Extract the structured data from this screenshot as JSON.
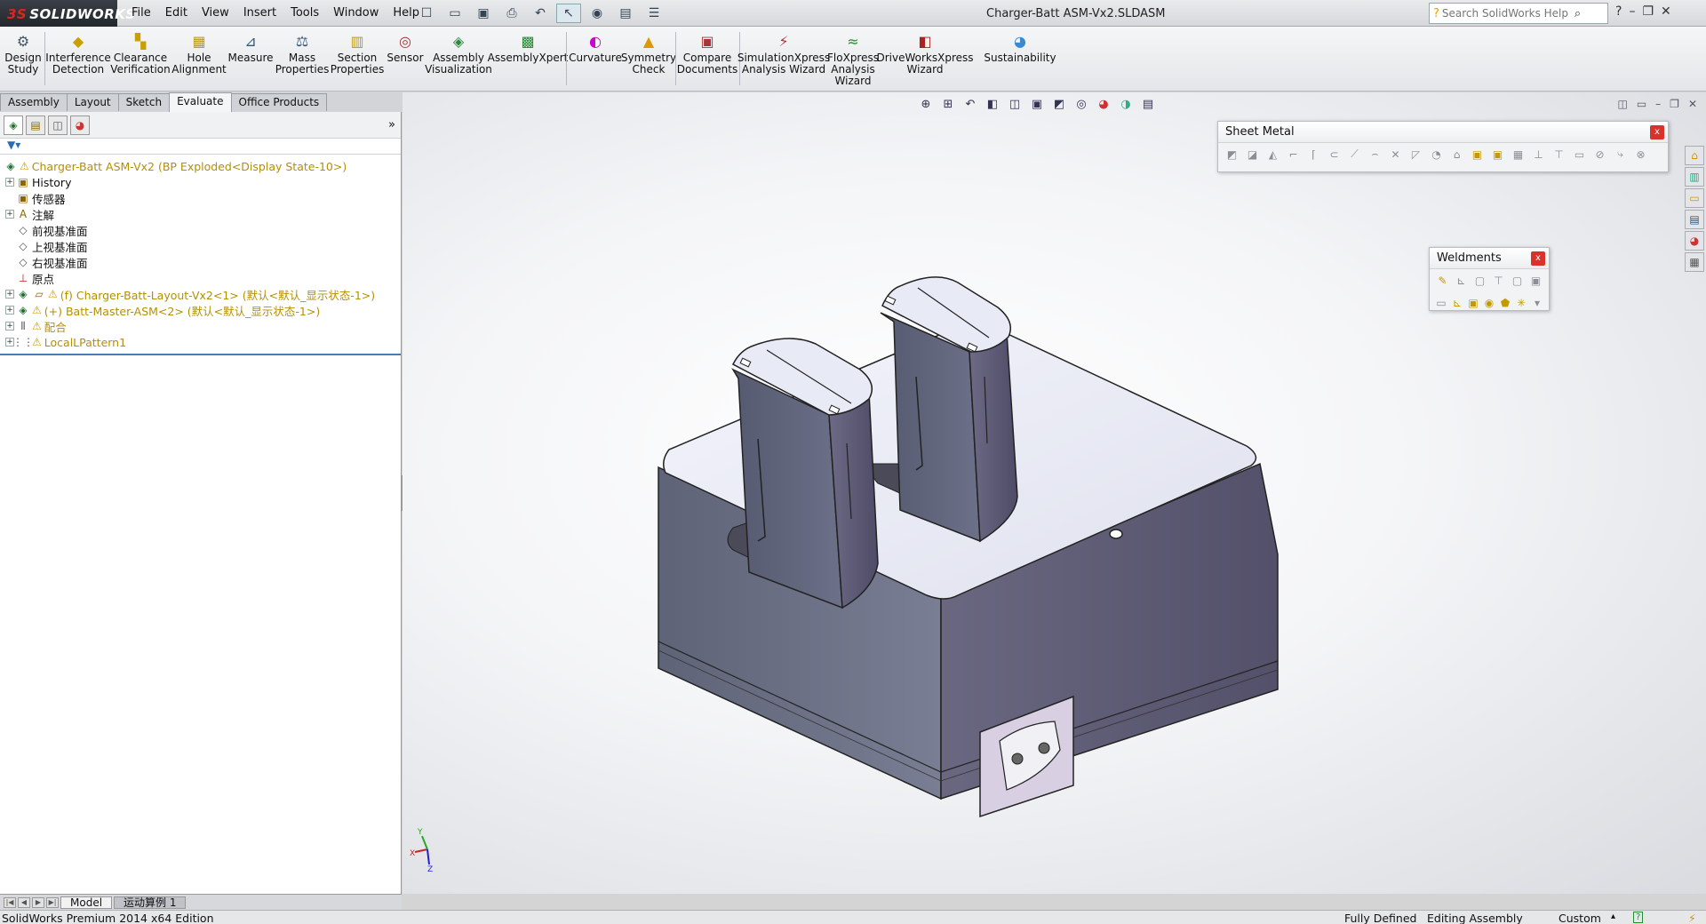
{
  "app": {
    "logo_text": "SOLIDWORKS",
    "title": "Charger-Batt ASM-Vx2.SLDASM"
  },
  "menu": [
    "File",
    "Edit",
    "View",
    "Insert",
    "Tools",
    "Window",
    "Help"
  ],
  "search": {
    "placeholder": "Search SolidWorks Help"
  },
  "command_manager": {
    "commands": [
      {
        "label": "Design Study",
        "icon": "design-study-icon"
      },
      {
        "label": "Interference Detection",
        "icon": "interference-icon"
      },
      {
        "label": "Clearance Verification",
        "icon": "clearance-icon"
      },
      {
        "label": "Hole Alignment",
        "icon": "hole-alignment-icon"
      },
      {
        "label": "Measure",
        "icon": "measure-icon"
      },
      {
        "label": "Mass Properties",
        "icon": "mass-properties-icon"
      },
      {
        "label": "Section Properties",
        "icon": "section-properties-icon"
      },
      {
        "label": "Sensor",
        "icon": "sensor-icon"
      },
      {
        "label": "Assembly Visualization",
        "icon": "assembly-visualization-icon"
      },
      {
        "label": "AssemblyXpert",
        "icon": "assemblyxpert-icon"
      },
      {
        "label": "Curvature",
        "icon": "curvature-icon"
      },
      {
        "label": "Symmetry Check",
        "icon": "symmetry-icon"
      },
      {
        "label": "Compare Documents",
        "icon": "compare-icon"
      },
      {
        "label": "SimulationXpress Analysis Wizard",
        "icon": "simulation-icon"
      },
      {
        "label": "FloXpress Analysis Wizard",
        "icon": "floxpress-icon"
      },
      {
        "label": "DriveWorksXpress Wizard",
        "icon": "driveworks-icon"
      },
      {
        "label": "Sustainability",
        "icon": "sustainability-icon"
      }
    ]
  },
  "tabs": [
    "Assembly",
    "Layout",
    "Sketch",
    "Evaluate",
    "Office Products"
  ],
  "active_tab": "Evaluate",
  "tree": {
    "root": "Charger-Batt ASM-Vx2  (BP Exploded<Display State-10>)",
    "items": [
      {
        "label": "History"
      },
      {
        "label": "传感器"
      },
      {
        "label": "注解"
      },
      {
        "label": "前视基准面"
      },
      {
        "label": "上视基准面"
      },
      {
        "label": "右视基准面"
      },
      {
        "label": "原点"
      },
      {
        "label": "(f) Charger-Batt-Layout-Vx2<1> (默认<默认_显示状态-1>)"
      },
      {
        "label": "(+) Batt-Master-ASM<2> (默认<默认_显示状态-1>)"
      },
      {
        "label": "配合"
      },
      {
        "label": "LocalLPattern1"
      }
    ]
  },
  "bottom_tabs": [
    "Model",
    "运动算例 1"
  ],
  "status": {
    "edition": "SolidWorks Premium 2014 x64 Edition",
    "defined": "Fully Defined",
    "mode": "Editing Assembly",
    "units": "Custom"
  },
  "toolbars": {
    "sheet_metal": "Sheet Metal",
    "weldments": "Weldments",
    "close": "x"
  },
  "triad": {
    "x": "X",
    "y": "Y",
    "z": "Z"
  },
  "colors": {
    "accent": "#d9322b",
    "tree_warning": "#d59a00",
    "selection": "#4a7bb8"
  }
}
